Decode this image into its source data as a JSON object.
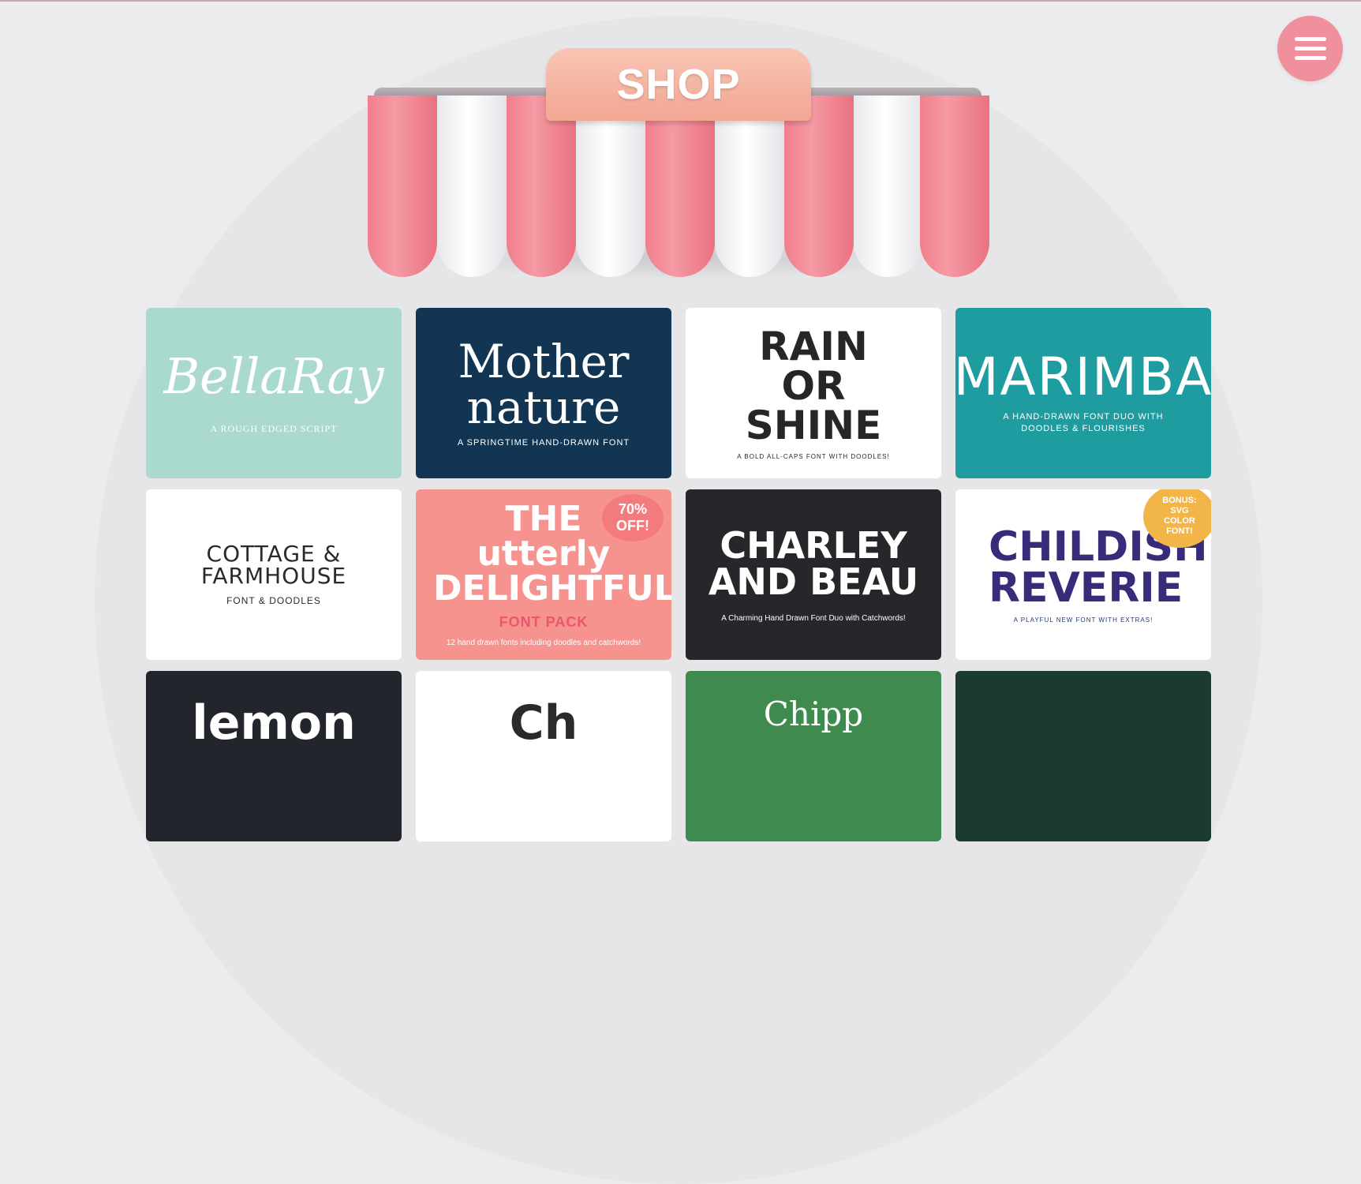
{
  "header": {
    "sign_text": "SHOP",
    "menu_icon": "hamburger-menu-icon",
    "menu_color": "#f0909d"
  },
  "awning": {
    "pink": "#f17f8c",
    "white": "#f4f4f6",
    "sign": "#f5b3a1"
  },
  "products": [
    {
      "name": "bella-ray",
      "title": "BellaRay",
      "subtitle": "A ROUGH EDGED SCRIPT",
      "bg": "#a9d9cf",
      "fg": "#ffffff"
    },
    {
      "name": "mother-nature",
      "title": "Mother nature",
      "subtitle": "A SPRINGTIME HAND-DRAWN FONT",
      "bg": "#113552",
      "fg": "#ffffff"
    },
    {
      "name": "rain-or-shine",
      "title": "RAIN OR SHINE",
      "subtitle": "A BOLD ALL-CAPS FONT WITH DOODLES!",
      "bg": "#ffffff",
      "fg": "#262626"
    },
    {
      "name": "marimba",
      "title": "MARIMBA",
      "subtitle": "A HAND-DRAWN FONT DUO WITH DOODLES & FLOURISHES",
      "bg": "#1f9ca0",
      "fg": "#ffffff"
    },
    {
      "name": "cottage-farmhouse",
      "title": "COTTAGE & FARMHOUSE",
      "subtitle": "FONT & DOODLES",
      "bg": "#ffffff",
      "fg": "#2a2a2a"
    },
    {
      "name": "delightful",
      "title": "THE utterly DELIGHTFUL",
      "subtitle": "FONT PACK",
      "extra": "12 hand drawn fonts including doodles and catchwords!",
      "badge": "70% OFF!",
      "bg": "#f7938f",
      "fg": "#ffffff"
    },
    {
      "name": "charley-and-beau",
      "title": "CHARLEY AND BEAU",
      "subtitle": "A Charming Hand Drawn Font Duo with Catchwords!",
      "bg": "#26262b",
      "fg": "#ffffff"
    },
    {
      "name": "childish-reverie",
      "title": "CHILDISH REVERIE",
      "subtitle": "A PLAYFUL NEW FONT WITH EXTRAS!",
      "badge": "BONUS: SVG COLOR FONT!",
      "bg": "#ffffff",
      "fg": "#1f3b73"
    },
    {
      "name": "lemon",
      "title": "lemon",
      "subtitle": "",
      "bg": "#22252c",
      "fg": "#ffffff"
    },
    {
      "name": "white-script",
      "title": "Ch",
      "subtitle": "",
      "bg": "#ffffff",
      "fg": "#2a2a2a"
    },
    {
      "name": "green-script",
      "title": "Chipp",
      "subtitle": "",
      "bg": "#3f8a4f",
      "fg": "#ffffff"
    },
    {
      "name": "floral",
      "title": "",
      "subtitle": "",
      "bg": "#1c3b30",
      "fg": "#f3b8b0"
    }
  ]
}
